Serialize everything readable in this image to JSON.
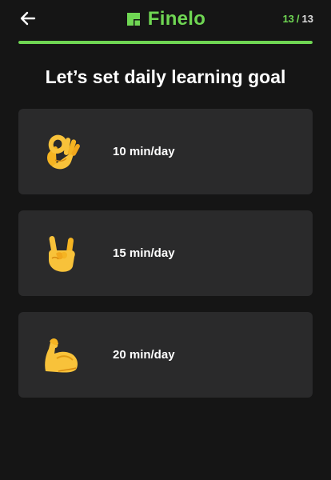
{
  "header": {
    "back_icon": "arrow-left-icon",
    "logo_icon": "finelo-logo-icon",
    "logo_text": "Finelo",
    "step_current": "13",
    "step_separator": "/",
    "step_total": "13",
    "brand_color": "#6fd653"
  },
  "progress": {
    "fraction": 1.0
  },
  "main": {
    "title": "Let’s set daily learning goal",
    "options": [
      {
        "emoji": "ok-hand-icon",
        "label": "10 min/day"
      },
      {
        "emoji": "sign-of-horns-icon",
        "label": "15 min/day"
      },
      {
        "emoji": "flexed-biceps-icon",
        "label": "20 min/day"
      }
    ]
  }
}
